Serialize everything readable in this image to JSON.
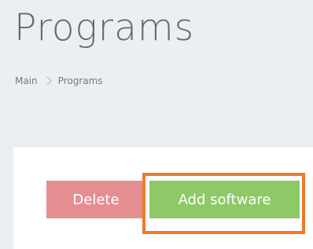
{
  "header": {
    "title": "Programs"
  },
  "breadcrumb": {
    "items": [
      "Main",
      "Programs"
    ]
  },
  "actions": {
    "delete_label": "Delete",
    "add_label": "Add software"
  },
  "colors": {
    "background": "#eceff2",
    "title": "#5f6b75",
    "delete_button": "#e58e92",
    "add_button": "#8ec968",
    "highlight": "#f07a28"
  }
}
